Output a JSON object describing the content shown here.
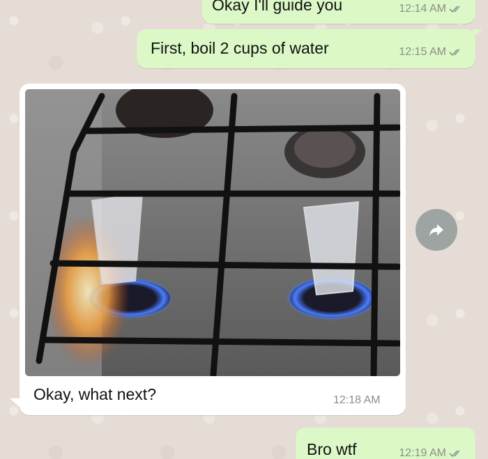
{
  "messages": [
    {
      "direction": "outgoing",
      "text": "Okay I'll guide you",
      "time": "12:14 AM",
      "status": "read"
    },
    {
      "direction": "outgoing",
      "text": "First, boil 2 cups of water",
      "time": "12:15 AM",
      "status": "read"
    },
    {
      "direction": "incoming",
      "type": "image",
      "caption": "Okay, what next?",
      "time": "12:18 AM",
      "image_icon": "photo-stove-glasses"
    },
    {
      "direction": "outgoing",
      "text": "Bro wtf",
      "time": "12:19 AM",
      "status": "read"
    }
  ],
  "forward_icon": "forward-arrow-icon",
  "colors": {
    "chat_background": "#e5ddd5",
    "outgoing_bubble": "#dcf8c6",
    "incoming_bubble": "#ffffff",
    "read_ticks": "#8a8f8a"
  }
}
